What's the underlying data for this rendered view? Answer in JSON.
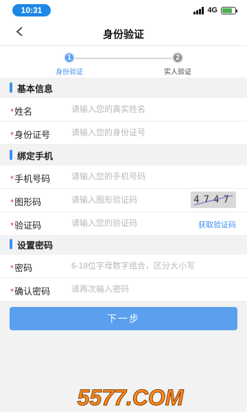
{
  "status_bar": {
    "time": "10:31",
    "network": "4G"
  },
  "header": {
    "title": "身份验证"
  },
  "steps": [
    {
      "number": "1",
      "label": "身份验证"
    },
    {
      "number": "2",
      "label": "实人验证"
    }
  ],
  "sections": {
    "basic": {
      "title": "基本信息"
    },
    "phone": {
      "title": "绑定手机"
    },
    "password": {
      "title": "设置密码"
    }
  },
  "fields": {
    "name": {
      "label": "姓名",
      "placeholder": "请输入您的真实姓名"
    },
    "id_number": {
      "label": "身份证号",
      "placeholder": "请输入您的身份证号"
    },
    "phone": {
      "label": "手机号码",
      "placeholder": "请输入您的手机号码"
    },
    "image_code": {
      "label": "图形码",
      "placeholder": "请输入图形验证码"
    },
    "sms_code": {
      "label": "验证码",
      "placeholder": "请输入您的验证码"
    },
    "password": {
      "label": "密码",
      "placeholder": "6-18位字母数字组合，区分大小写"
    },
    "confirm_password": {
      "label": "确认密码",
      "placeholder": "请再次输入密码"
    }
  },
  "captcha_text": "4747",
  "get_code_label": "获取验证码",
  "submit_label": "下一步",
  "required_mark": "*",
  "watermark": "5577.COM"
}
